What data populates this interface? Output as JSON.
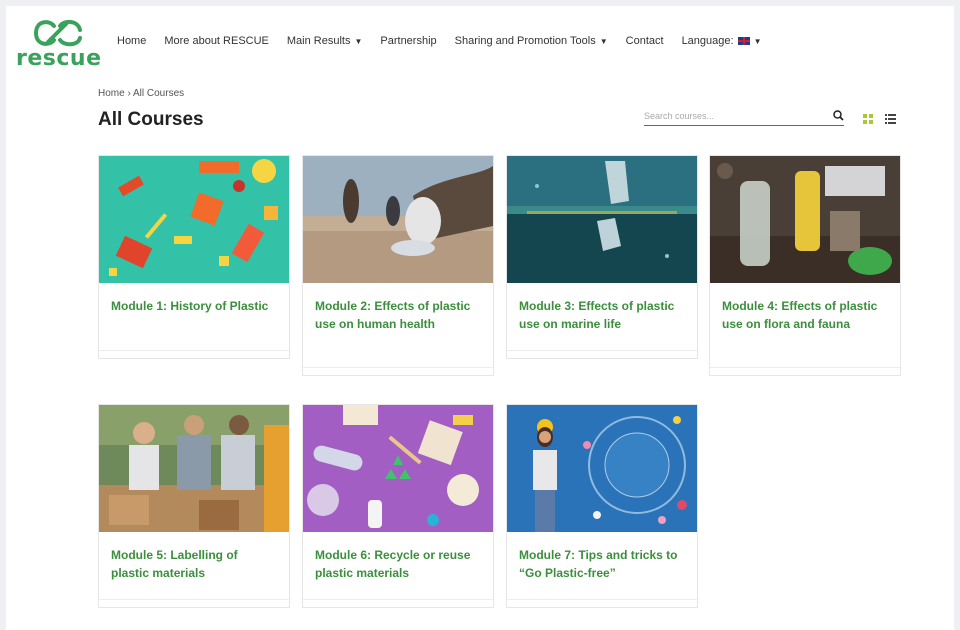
{
  "brand": {
    "logo_text": "rescue",
    "accent": "#3aa35b"
  },
  "nav": {
    "items": [
      {
        "label": "Home",
        "dropdown": false
      },
      {
        "label": "More about RESCUE",
        "dropdown": false
      },
      {
        "label": "Main Results",
        "dropdown": true
      },
      {
        "label": "Partnership",
        "dropdown": false
      },
      {
        "label": "Sharing and Promotion Tools",
        "dropdown": true
      },
      {
        "label": "Contact",
        "dropdown": false
      },
      {
        "label": "Language:",
        "dropdown": true,
        "icon": "uk-flag-icon"
      }
    ]
  },
  "breadcrumb": "Home › All Courses",
  "page_title": "All Courses",
  "search": {
    "placeholder": "Search courses..."
  },
  "courses": [
    {
      "title": "Module 1: History of Plastic"
    },
    {
      "title": "Module 2: Effects of plastic use on human health"
    },
    {
      "title": "Module 3: Effects of plastic use on marine life"
    },
    {
      "title": "Module 4: Effects of plastic use on flora and fauna"
    },
    {
      "title": "Module 5: Labelling of plastic materials"
    },
    {
      "title": "Module 6: Recycle or reuse plastic materials"
    },
    {
      "title": "Module 7: Tips and tricks to “Go Plastic-free”"
    }
  ]
}
